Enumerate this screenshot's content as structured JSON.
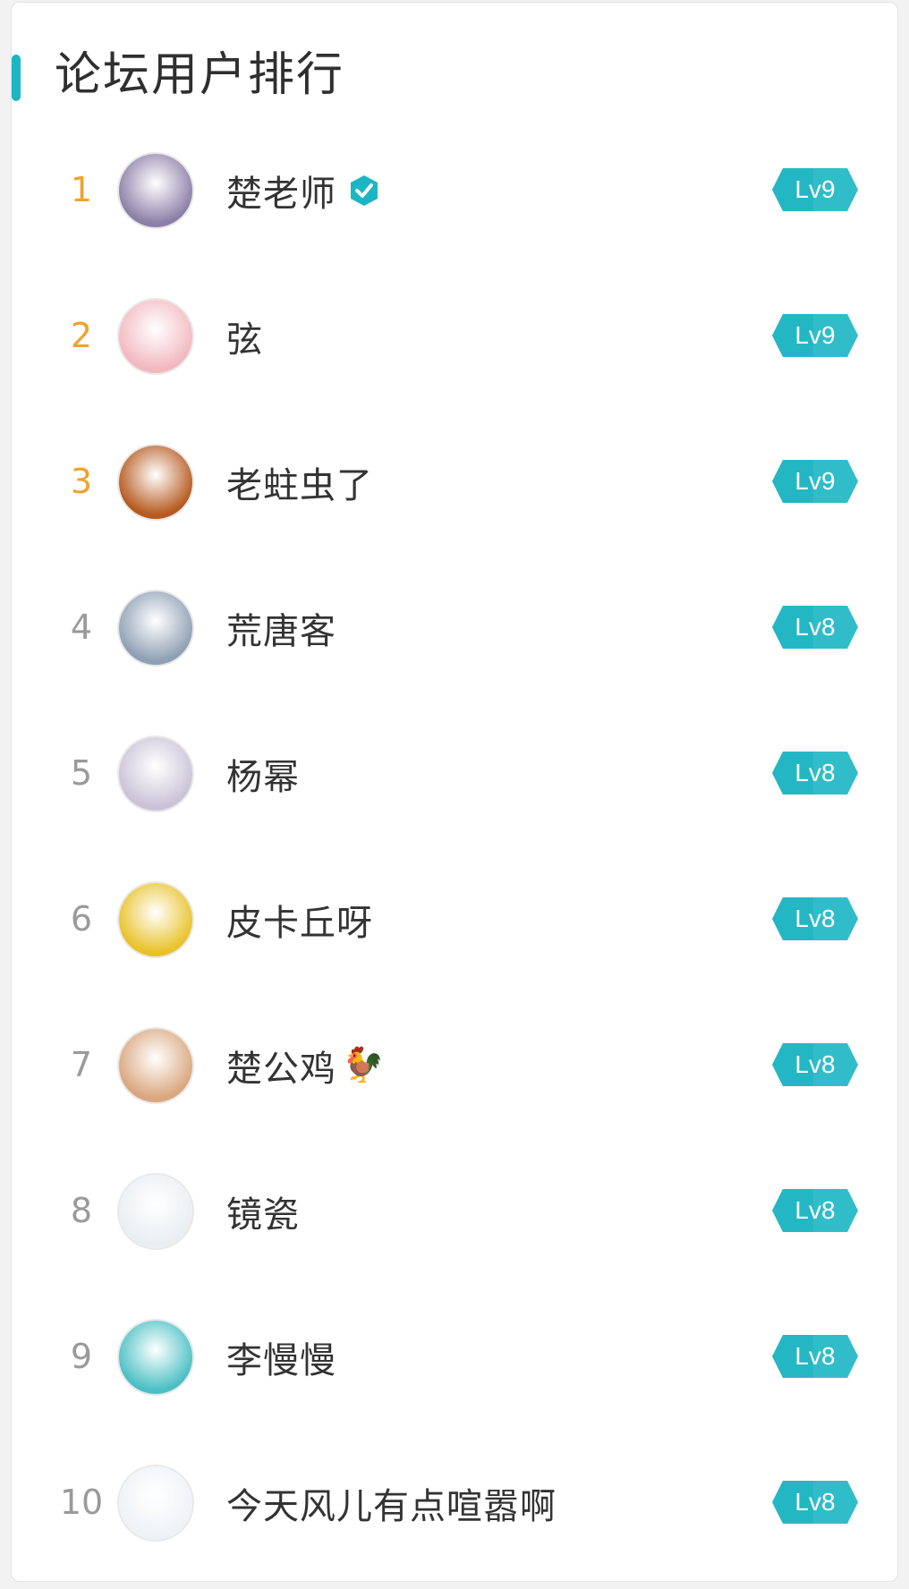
{
  "header": {
    "title": "论坛用户排行"
  },
  "colors": {
    "accent": "#1bb6c3",
    "top_rank": "#f0a22e",
    "rank": "#9a9a9a",
    "badge": "#23b7c3"
  },
  "users": [
    {
      "rank": "1",
      "name": "楚老师",
      "level": "Lv9",
      "verified": true,
      "emoji": "",
      "avatar_icon": "girl-avatar",
      "avatar_color": "#8c7fa8"
    },
    {
      "rank": "2",
      "name": "弦",
      "level": "Lv9",
      "verified": false,
      "emoji": "",
      "avatar_icon": "anime-girl-avatar",
      "avatar_color": "#f2b8c0"
    },
    {
      "rank": "3",
      "name": "老蛀虫了",
      "level": "Lv9",
      "verified": false,
      "emoji": "",
      "avatar_icon": "treasure-avatar",
      "avatar_color": "#b65a1f"
    },
    {
      "rank": "4",
      "name": "荒唐客",
      "level": "Lv8",
      "verified": false,
      "emoji": "",
      "avatar_icon": "anime-face-avatar",
      "avatar_color": "#8fa0b4"
    },
    {
      "rank": "5",
      "name": "杨幂",
      "level": "Lv8",
      "verified": false,
      "emoji": "",
      "avatar_icon": "woman-avatar",
      "avatar_color": "#c9c3d6"
    },
    {
      "rank": "6",
      "name": "皮卡丘呀",
      "level": "Lv8",
      "verified": false,
      "emoji": "",
      "avatar_icon": "pikachu-avatar",
      "avatar_color": "#e8c22a"
    },
    {
      "rank": "7",
      "name": "楚公鸡",
      "level": "Lv8",
      "verified": false,
      "emoji": "🐓",
      "avatar_icon": "woman-photo-avatar",
      "avatar_color": "#d9a67e"
    },
    {
      "rank": "8",
      "name": "镜瓷",
      "level": "Lv8",
      "verified": false,
      "emoji": "",
      "avatar_icon": "sketch-avatar",
      "avatar_color": "#e9eef0"
    },
    {
      "rank": "9",
      "name": "李慢慢",
      "level": "Lv8",
      "verified": false,
      "emoji": "",
      "avatar_icon": "monster-avatar",
      "avatar_color": "#4bbfc4"
    },
    {
      "rank": "10",
      "name": "今天风儿有点喧嚣啊",
      "level": "Lv8",
      "verified": false,
      "emoji": "",
      "avatar_icon": "white-hair-avatar",
      "avatar_color": "#eef2f6"
    }
  ]
}
